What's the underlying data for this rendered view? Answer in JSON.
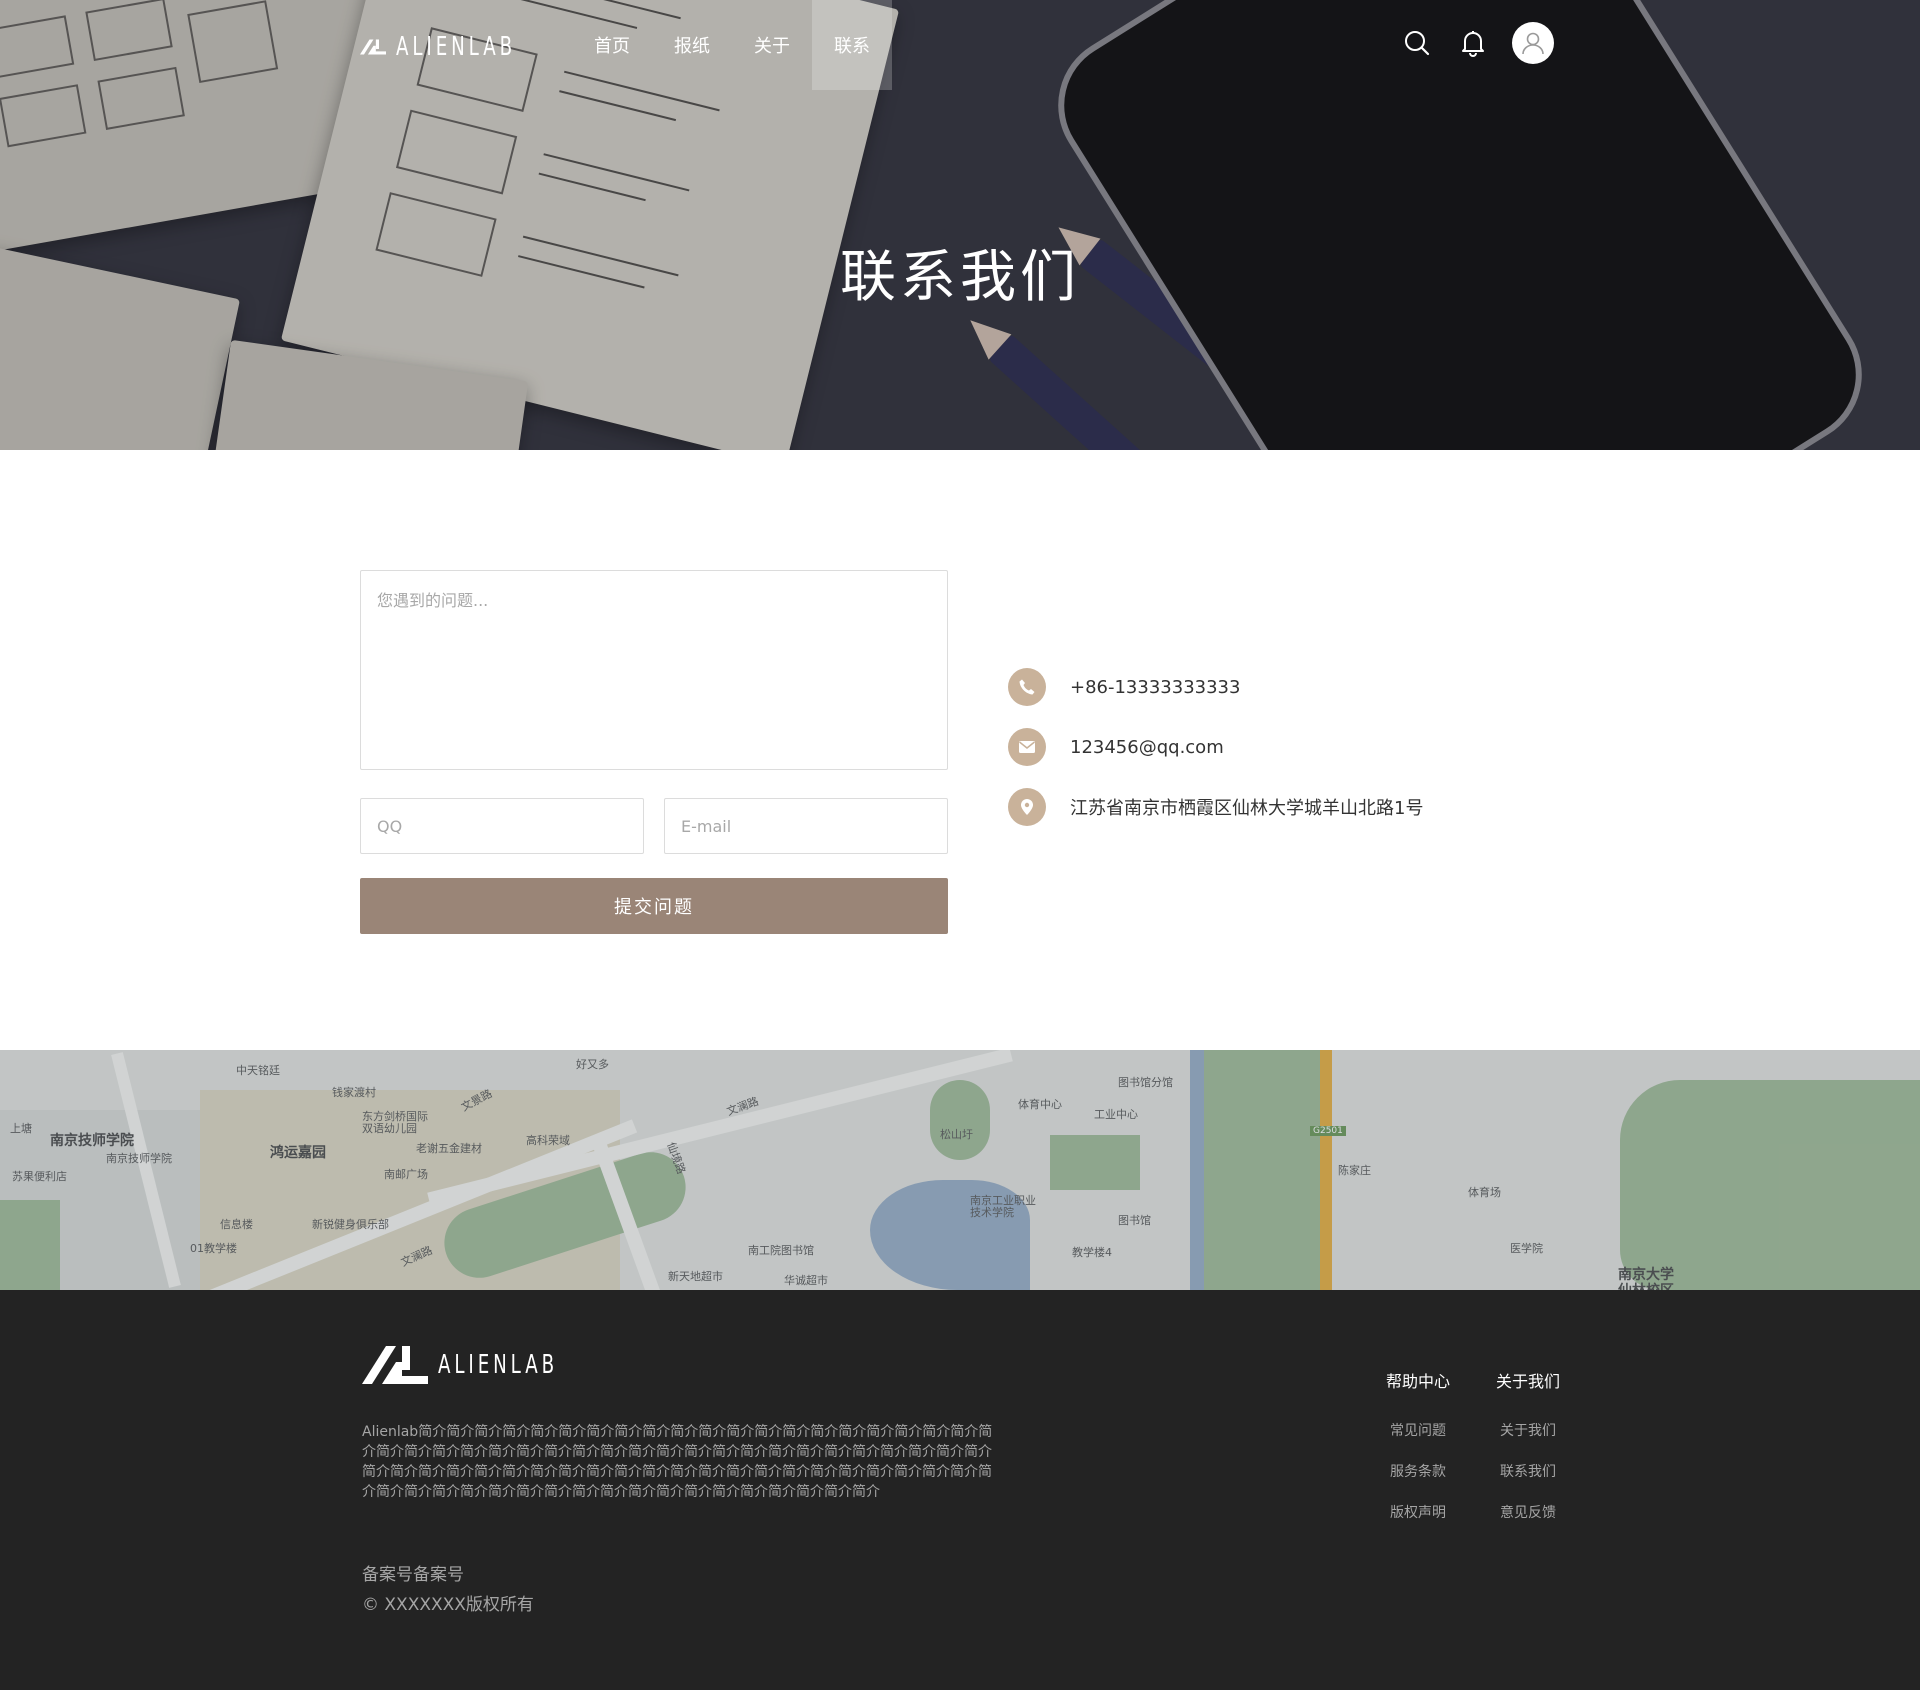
{
  "brand": {
    "name": "ALIENLAB"
  },
  "nav": {
    "items": [
      {
        "label": "首页"
      },
      {
        "label": "报纸"
      },
      {
        "label": "关于"
      },
      {
        "label": "联系"
      }
    ],
    "active_index": 3
  },
  "icons": {
    "search": "search-icon",
    "bell": "bell-icon",
    "avatar": "user-avatar-icon"
  },
  "hero": {
    "title": "联系我们"
  },
  "form": {
    "question_placeholder": "您遇到的问题...",
    "qq_placeholder": "QQ",
    "email_placeholder": "E-mail",
    "submit_label": "提交问题"
  },
  "contact": {
    "phone": "+86-13333333333",
    "email": "123456@qq.com",
    "address": "江苏省南京市栖霞区仙林大学城羊山北路1号"
  },
  "map": {
    "labels": [
      "中天铭廷",
      "钱家渡村",
      "东方剑桥国际",
      "双语幼儿园",
      "文景路",
      "好又多",
      "文澜路",
      "高科荣域",
      "南京技师学院",
      "南京技师学院",
      "鸿运嘉园",
      "老谢五金建材",
      "苏果便利店",
      "南邮广场",
      "上塘",
      "信息楼",
      "新锐健身俱乐部",
      "01教学楼",
      "文澜路",
      "仙境路",
      "南工院图书馆",
      "新天地超市",
      "华诚超市",
      "松山圩",
      "体育中心",
      "工业中心",
      "图书馆分馆",
      "南京工业职业",
      "技术学院",
      "图书馆",
      "教学楼4",
      "G2501",
      "陈家庄",
      "体育场",
      "医学院",
      "南京大学",
      "仙林校区"
    ]
  },
  "footer": {
    "brand": "ALIENLAB",
    "description": "Alienlab简介简介简介简介简介简介简介简介简介简介简介简介简介简介简介简介简介简介简介简介简介简介简介简介简介简介简介简介简介简介简介简介简介简介简介简介简介简介简介简介简介简介简介简介简介简介简介简介简介简介简介简介简介简介简介简介简介简介简介简介简介简介简介简介简介简介简介简介简介简介简介简介简介简介简介简介简介简介简介简介简介简介简介简介",
    "icp": "备案号备案号",
    "copyright": "© XXXXXXX版权所有",
    "columns": [
      {
        "title": "帮助中心",
        "links": [
          "常见问题",
          "服务条款",
          "版权声明"
        ]
      },
      {
        "title": "关于我们",
        "links": [
          "关于我们",
          "联系我们",
          "意见反馈"
        ]
      }
    ]
  }
}
